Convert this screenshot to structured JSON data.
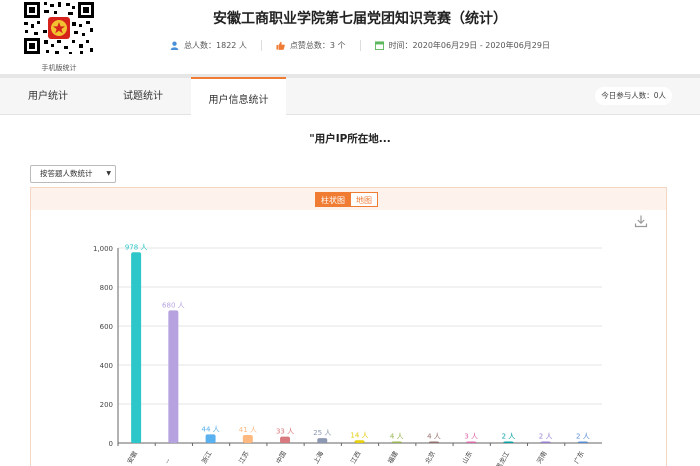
{
  "header": {
    "title": "安徽工商职业学院第七届党团知识竞赛（统计）",
    "qr_caption": "手机版统计",
    "stats": [
      {
        "icon": "user-icon",
        "text": "总人数：1822 人"
      },
      {
        "icon": "thumbs-up-icon",
        "text": "点赞总数：3 个"
      },
      {
        "icon": "calendar-icon",
        "text": "时间：2020年06月29日 - 2020年06月29日"
      }
    ]
  },
  "tabs": [
    {
      "label": "用户统计",
      "active": false
    },
    {
      "label": "试题统计",
      "active": false
    },
    {
      "label": "用户信息统计",
      "active": true
    }
  ],
  "online": {
    "text": "今日参与人数：0人"
  },
  "content": {
    "title": "\"用户IP所在地...",
    "select_value": "按答题人数统计",
    "toggle": {
      "bar": "柱状图",
      "map": "地图"
    }
  },
  "colors": {
    "accent": "#f07b33"
  },
  "chart_data": {
    "type": "bar",
    "categories": [
      "安徽",
      "--",
      "浙江",
      "江苏",
      "中国",
      "上海",
      "江西",
      "福建",
      "北京",
      "山东",
      "黑龙江",
      "河南",
      "广东"
    ],
    "values": [
      978,
      680,
      44,
      41,
      33,
      25,
      14,
      4,
      4,
      3,
      2,
      2,
      2
    ],
    "labels": [
      "978 人",
      "680 人",
      "44 人",
      "41 人",
      "33 人",
      "25 人",
      "14 人",
      "4 人",
      "4 人",
      "3 人",
      "2 人",
      "2 人",
      "2 人"
    ],
    "colors": [
      "#2ec7c9",
      "#b6a2de",
      "#5ab1ef",
      "#ffb980",
      "#d87a80",
      "#8d98b3",
      "#e5cf0d",
      "#97b552",
      "#95706d",
      "#dc69aa",
      "#07a2a4",
      "#9a7fd1",
      "#588dd5"
    ],
    "yticks": [
      0,
      200,
      400,
      600,
      800,
      "1,000"
    ],
    "ylim": [
      0,
      1000
    ],
    "grid": true
  }
}
